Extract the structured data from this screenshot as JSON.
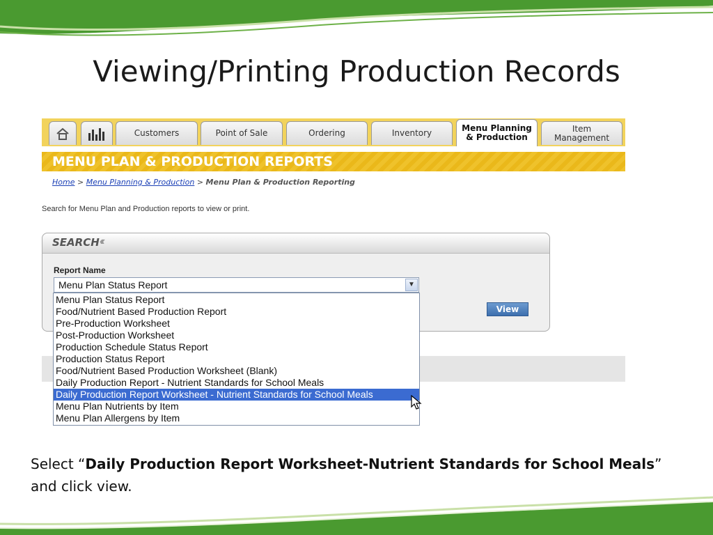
{
  "slide": {
    "title": "Viewing/Printing Production Records",
    "caption_prefix": "Select “",
    "caption_bold": "Daily Production Report Worksheet-Nutrient Standards for School Meals",
    "caption_suffix": "”",
    "caption_line2": "and click view."
  },
  "colors": {
    "tabbar": "#f2d35c",
    "banner": "#eab81a",
    "selected_option": "#3b6bd1",
    "wave_green": "#3e8f2a"
  },
  "nav": {
    "home_icon": "home-icon",
    "chart_icon": "bar-chart-icon",
    "tabs": [
      {
        "label": "Customers"
      },
      {
        "label": "Point of Sale"
      },
      {
        "label": "Ordering"
      },
      {
        "label": "Inventory"
      },
      {
        "label_line1": "Menu Planning",
        "label_line2": "& Production",
        "active": true
      },
      {
        "label_line1": "Item",
        "label_line2": "Management"
      }
    ]
  },
  "banner": {
    "title": "MENU PLAN & PRODUCTION REPORTS"
  },
  "breadcrumb": {
    "home": "Home",
    "sep1": " > ",
    "section": "Menu Planning & Production",
    "sep2": " > ",
    "current": "Menu Plan & Production Reporting"
  },
  "instructions": "Search for Menu Plan and Production reports to view or print.",
  "search": {
    "title": "SEARCH",
    "chevrons": "‹‹‹",
    "field_label": "Report Name",
    "selected_value": "Menu Plan Status Report",
    "view_button": "View",
    "options": [
      "Menu Plan Status Report",
      "Food/Nutrient Based Production Report",
      "Pre-Production Worksheet",
      "Post-Production Worksheet",
      "Production Schedule Status Report",
      "Production Status Report",
      "Food/Nutrient Based Production Worksheet (Blank)",
      "Daily Production Report - Nutrient Standards for School Meals",
      "Daily Production Report Worksheet - Nutrient Standards for School Meals",
      "Menu Plan Nutrients by Item",
      "Menu Plan Allergens by Item"
    ],
    "highlighted_index": 8
  }
}
